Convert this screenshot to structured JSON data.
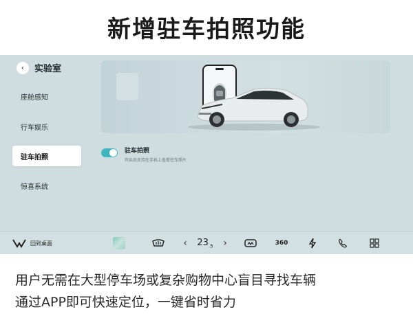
{
  "headline": "新增驻车拍照功能",
  "header": {
    "back_icon": "chevron-left-icon",
    "title": "实验室"
  },
  "sidebar": {
    "items": [
      {
        "label": "座舱感知",
        "active": false
      },
      {
        "label": "行车娱乐",
        "active": false
      },
      {
        "label": "驻车拍照",
        "active": true
      },
      {
        "label": "惊喜系统",
        "active": false
      }
    ]
  },
  "setting": {
    "title": "驻车拍照",
    "description": "开启后支持在手机上查看驻车照片",
    "enabled": true,
    "accent": "#3fb6bf"
  },
  "dock": {
    "home_label": "回到桌面",
    "temperature_main": "23",
    "temperature_decimal": ".5",
    "icons": [
      "logo-icon",
      "app-thumbnail-icon",
      "rear-defrost-icon",
      "chevron-left-icon",
      "chevron-right-icon",
      "front-defrost-icon",
      "360-camera-icon",
      "power-icon",
      "phone-icon",
      "grid-icon"
    ],
    "camera_label": "360"
  },
  "caption": {
    "line1": "用户无需在大型停车场或复杂购物中心盲目寻找车辆",
    "line2": "通过APP即可快速定位，一键省时省力"
  }
}
